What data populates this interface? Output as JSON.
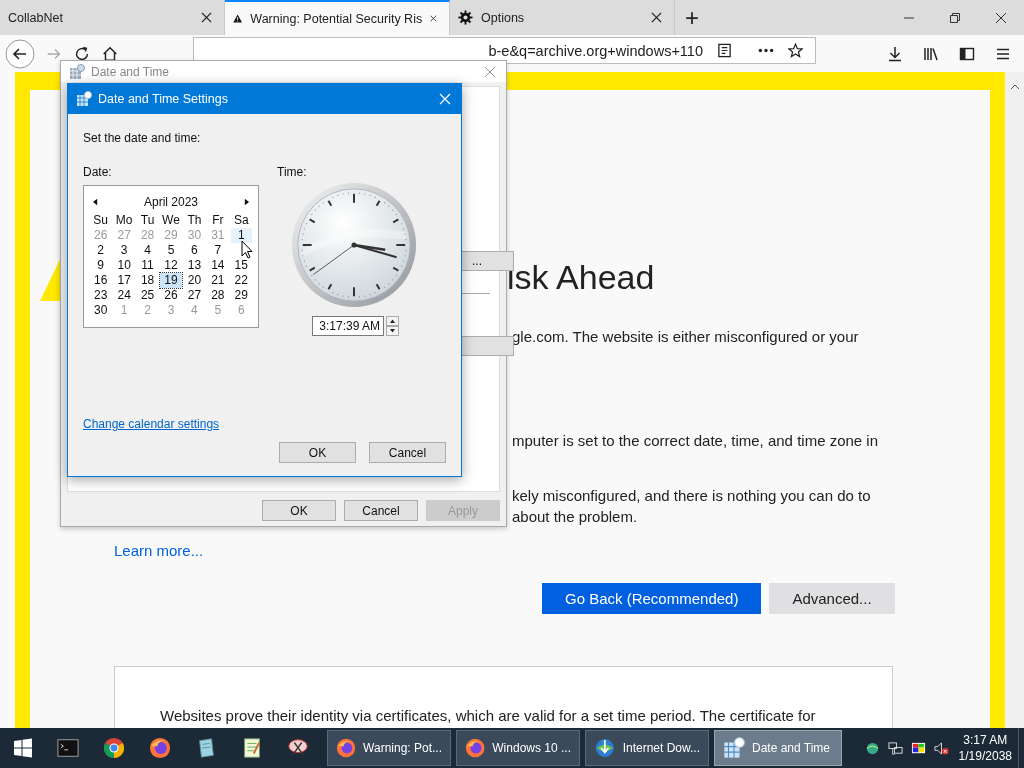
{
  "browser": {
    "tabs": [
      {
        "title": "CollabNet",
        "kind": "plain",
        "selected": false
      },
      {
        "title": "Warning: Potential Security Ris",
        "kind": "warning",
        "selected": true
      },
      {
        "title": "Options",
        "kind": "settings",
        "selected": false
      }
    ],
    "new_tab": "+",
    "url": "b-e&q=archive.org+windows+110",
    "page": {
      "heading": "isk Ahead",
      "lines": [
        "gle.com. The website is either misconfigured or your",
        "mputer is set to the correct date, time, and time zone in",
        "kely misconfigured, and there is nothing you can do to",
        "about the problem."
      ],
      "learn_more": "Learn more...",
      "buttons": [
        {
          "label": "Go Back (Recommended)",
          "kind": "primary"
        },
        {
          "label": "Advanced...",
          "kind": "secondary"
        }
      ],
      "certificate_text": "Websites prove their identity via certificates, which are valid for a set time period. The certificate for"
    }
  },
  "date_time_window": {
    "title": "Date and Time",
    "partial_button": "...",
    "buttons": [
      {
        "label": "OK",
        "disabled": false
      },
      {
        "label": "Cancel",
        "disabled": false
      },
      {
        "label": "Apply",
        "disabled": true
      }
    ]
  },
  "settings_dialog": {
    "title": "Date and Time Settings",
    "prompt": "Set the date and time:",
    "date_label": "Date:",
    "time_label": "Time:",
    "calendar": {
      "month": "April 2023",
      "weekdays": [
        "Su",
        "Mo",
        "Tu",
        "We",
        "Th",
        "Fr",
        "Sa"
      ],
      "weeks": [
        [
          {
            "day": "26",
            "dim": true,
            "selected": false,
            "hovered": false
          },
          {
            "day": "27",
            "dim": true,
            "selected": false,
            "hovered": false
          },
          {
            "day": "28",
            "dim": true,
            "selected": false,
            "hovered": false
          },
          {
            "day": "29",
            "dim": true,
            "selected": false,
            "hovered": false
          },
          {
            "day": "30",
            "dim": true,
            "selected": false,
            "hovered": false
          },
          {
            "day": "31",
            "dim": true,
            "selected": false,
            "hovered": false
          },
          {
            "day": "1",
            "dim": false,
            "selected": false,
            "hovered": true
          }
        ],
        [
          {
            "day": "2",
            "dim": false,
            "selected": false,
            "hovered": false
          },
          {
            "day": "3",
            "dim": false,
            "selected": false,
            "hovered": false
          },
          {
            "day": "4",
            "dim": false,
            "selected": false,
            "hovered": false
          },
          {
            "day": "5",
            "dim": false,
            "selected": false,
            "hovered": false
          },
          {
            "day": "6",
            "dim": false,
            "selected": false,
            "hovered": false
          },
          {
            "day": "7",
            "dim": false,
            "selected": false,
            "hovered": false
          }
        ],
        [
          {
            "day": "9",
            "dim": false,
            "selected": false,
            "hovered": false
          },
          {
            "day": "10",
            "dim": false,
            "selected": false,
            "hovered": false
          },
          {
            "day": "11",
            "dim": false,
            "selected": false,
            "hovered": false
          },
          {
            "day": "12",
            "dim": false,
            "selected": false,
            "hovered": false
          },
          {
            "day": "13",
            "dim": false,
            "selected": false,
            "hovered": false
          },
          {
            "day": "14",
            "dim": false,
            "selected": false,
            "hovered": false
          },
          {
            "day": "15",
            "dim": false,
            "selected": false,
            "hovered": false
          }
        ],
        [
          {
            "day": "16",
            "dim": false,
            "selected": false,
            "hovered": false
          },
          {
            "day": "17",
            "dim": false,
            "selected": false,
            "hovered": false
          },
          {
            "day": "18",
            "dim": false,
            "selected": false,
            "hovered": false
          },
          {
            "day": "19",
            "dim": false,
            "selected": true,
            "hovered": false
          },
          {
            "day": "20",
            "dim": false,
            "selected": false,
            "hovered": false
          },
          {
            "day": "21",
            "dim": false,
            "selected": false,
            "hovered": false
          },
          {
            "day": "22",
            "dim": false,
            "selected": false,
            "hovered": false
          }
        ],
        [
          {
            "day": "23",
            "dim": false,
            "selected": false,
            "hovered": false
          },
          {
            "day": "24",
            "dim": false,
            "selected": false,
            "hovered": false
          },
          {
            "day": "25",
            "dim": false,
            "selected": false,
            "hovered": false
          },
          {
            "day": "26",
            "dim": false,
            "selected": false,
            "hovered": false
          },
          {
            "day": "27",
            "dim": false,
            "selected": false,
            "hovered": false
          },
          {
            "day": "28",
            "dim": false,
            "selected": false,
            "hovered": false
          },
          {
            "day": "29",
            "dim": false,
            "selected": false,
            "hovered": false
          }
        ],
        [
          {
            "day": "30",
            "dim": false,
            "selected": false,
            "hovered": false
          },
          {
            "day": "1",
            "dim": true,
            "selected": false,
            "hovered": false
          },
          {
            "day": "2",
            "dim": true,
            "selected": false,
            "hovered": false
          },
          {
            "day": "3",
            "dim": true,
            "selected": false,
            "hovered": false
          },
          {
            "day": "4",
            "dim": true,
            "selected": false,
            "hovered": false
          },
          {
            "day": "5",
            "dim": true,
            "selected": false,
            "hovered": false
          },
          {
            "day": "6",
            "dim": true,
            "selected": false,
            "hovered": false
          }
        ]
      ]
    },
    "time_value": "3:17:39 AM",
    "link": "Change calendar settings",
    "buttons": [
      "OK",
      "Cancel"
    ]
  },
  "taskbar": {
    "tasks": [
      {
        "label": "Warning: Pot...",
        "kind": "firefox",
        "selected": false
      },
      {
        "label": "Windows 10 ...",
        "kind": "firefox",
        "selected": false
      },
      {
        "label": "Internet Dow...",
        "kind": "downloader",
        "selected": false
      },
      {
        "label": "Date and Time",
        "kind": "calendar",
        "selected": true
      }
    ],
    "clock": {
      "time": "3:17 AM",
      "date": "1/19/2038"
    }
  }
}
